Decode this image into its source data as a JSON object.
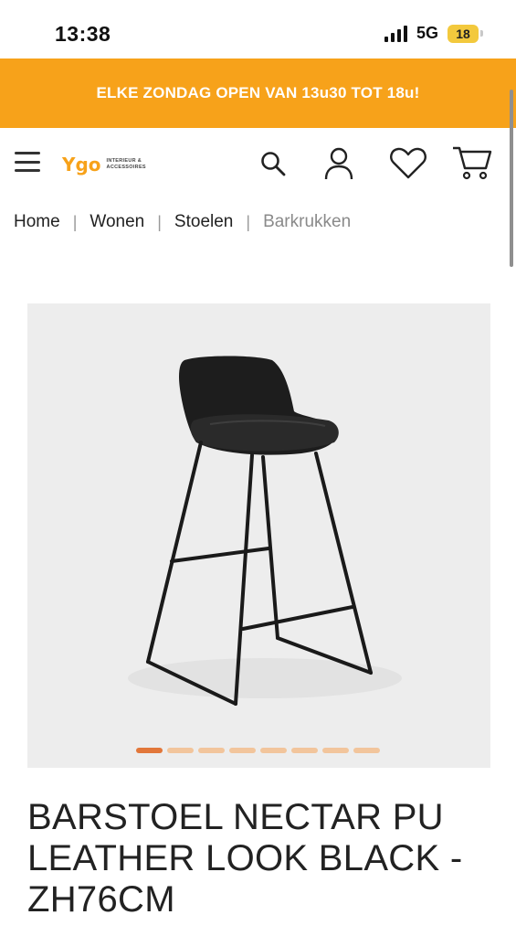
{
  "status_bar": {
    "time": "13:38",
    "network": "5G",
    "battery": "18"
  },
  "promo": {
    "text": "ELKE ZONDAG OPEN VAN 13u30 TOT 18u!"
  },
  "header": {
    "logo_mark": "Ygo",
    "logo_sub_line1": "INTERIEUR &",
    "logo_sub_line2": "ACCESSOIRES",
    "icons": [
      "menu-icon",
      "search-icon",
      "account-icon",
      "wishlist-icon",
      "cart-icon"
    ]
  },
  "breadcrumb": {
    "items": [
      "Home",
      "Wonen",
      "Stoelen",
      "Barkrukken"
    ],
    "separator": "|"
  },
  "gallery": {
    "image_count": 8,
    "active_index": 0
  },
  "product": {
    "title": "BARSTOEL NECTAR PU LEATHER LOOK BLACK - ZH76CM"
  },
  "colors": {
    "accent": "#f7a21a",
    "dot_active": "#e2773a",
    "dot_inactive": "#f2c59c"
  }
}
